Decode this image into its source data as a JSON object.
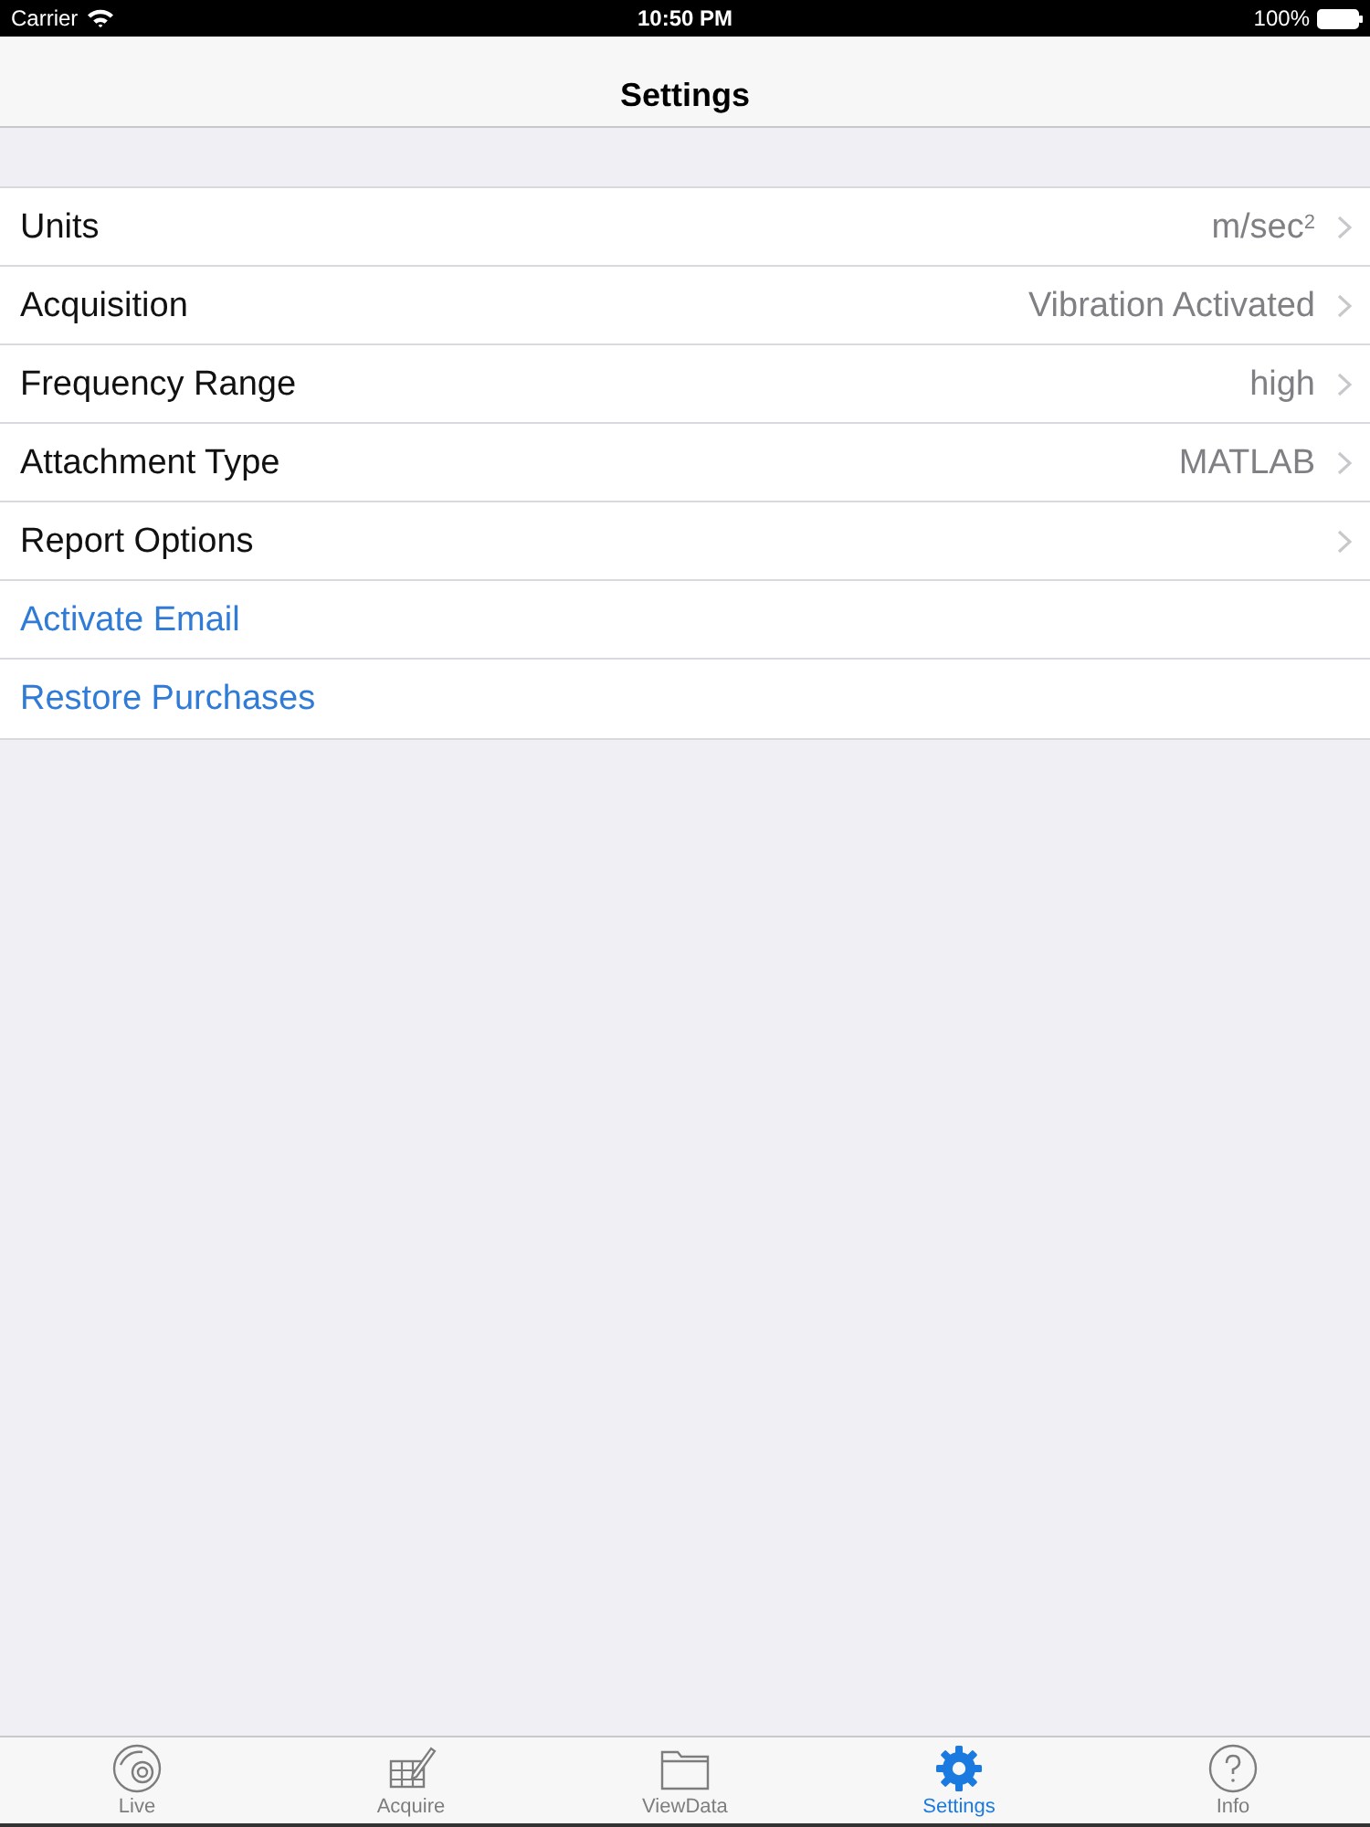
{
  "status_bar": {
    "carrier": "Carrier",
    "time": "10:50 PM",
    "battery": "100%"
  },
  "nav_bar": {
    "title": "Settings"
  },
  "settings": [
    {
      "kind": "disclosure",
      "label": "Units",
      "value": "m/sec$^{2}$"
    },
    {
      "kind": "disclosure",
      "label": "Acquisition",
      "value": "Vibration Activated"
    },
    {
      "kind": "disclosure",
      "label": "Frequency Range",
      "value": "high"
    },
    {
      "kind": "disclosure",
      "label": "Attachment Type",
      "value": "MATLAB"
    },
    {
      "kind": "disclosure",
      "label": "Report Options"
    },
    {
      "kind": "action",
      "label": "Activate Email"
    },
    {
      "kind": "action",
      "label": "Restore Purchases"
    }
  ],
  "tab_bar": [
    {
      "label": "Live",
      "selected": false
    },
    {
      "label": "Acquire",
      "selected": false
    },
    {
      "label": "ViewData",
      "selected": false
    },
    {
      "label": "Settings",
      "selected": true
    },
    {
      "label": "Info",
      "selected": false
    }
  ]
}
